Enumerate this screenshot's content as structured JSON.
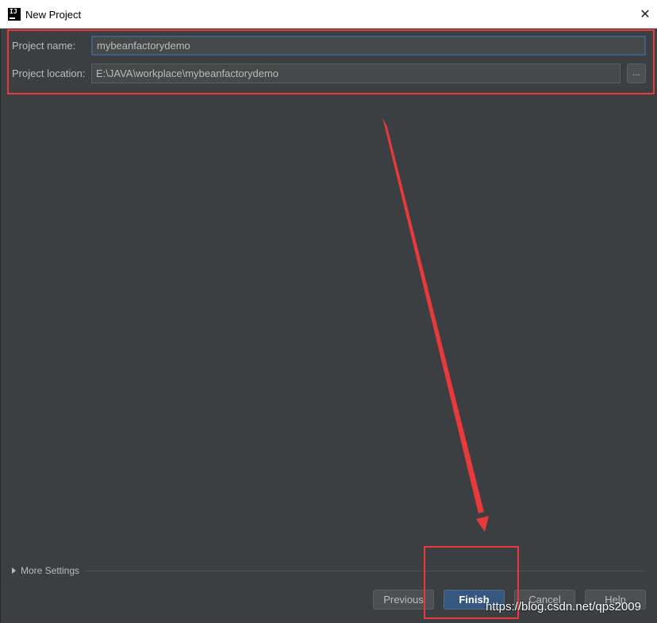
{
  "window": {
    "title": "New Project",
    "close_glyph": "✕",
    "app_icon": "intellij-icon",
    "app_icon_text": "IJ"
  },
  "form": {
    "project_name_label": "Project name:",
    "project_name_value": "mybeanfactorydemo",
    "project_location_label": "Project location:",
    "project_location_value": "E:\\JAVA\\workplace\\mybeanfactorydemo",
    "browse_label": "..."
  },
  "more_settings": {
    "label": "More Settings",
    "icon": "expand-triangle-icon"
  },
  "buttons": {
    "previous": "Previous",
    "finish": "Finish",
    "cancel": "Cancel",
    "help": "Help"
  },
  "annotations": {
    "highlight_color": "#e8393c",
    "arrow_icon": "red-arrow"
  },
  "watermark": "https://blog.csdn.net/qps2009",
  "colors": {
    "background": "#3c3f41",
    "primary_button": "#365880",
    "focus_border": "#3d6185"
  }
}
